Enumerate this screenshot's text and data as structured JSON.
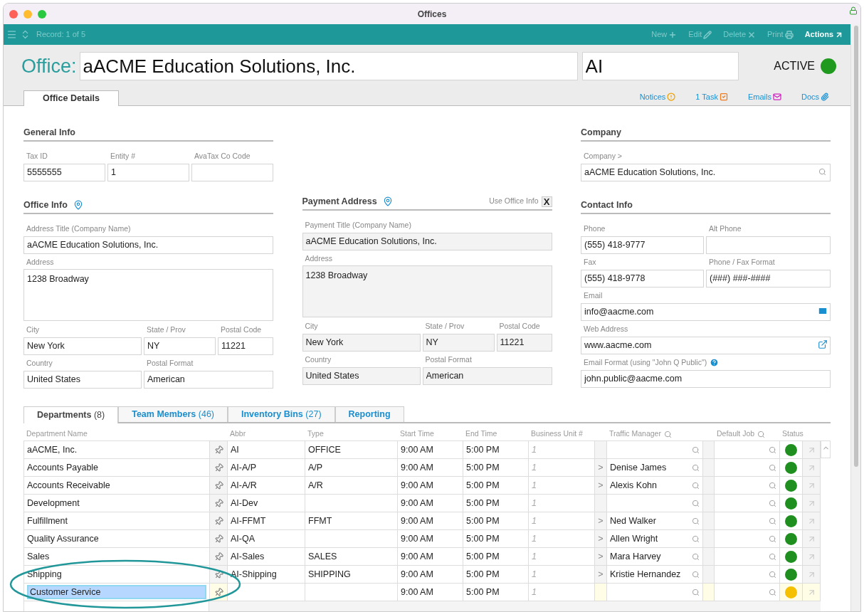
{
  "window": {
    "title": "Offices"
  },
  "toolbar": {
    "record": "Record: 1 of 5",
    "actions": [
      {
        "kind": "new",
        "label": "New",
        "disabled": true
      },
      {
        "kind": "edit",
        "label": "Edit",
        "disabled": true
      },
      {
        "kind": "delete",
        "label": "Delete",
        "disabled": true
      },
      {
        "kind": "print",
        "label": "Print",
        "disabled": true
      },
      {
        "kind": "actions",
        "label": "Actions",
        "disabled": false
      }
    ]
  },
  "header": {
    "label": "Office:",
    "name": "aACME Education Solutions, Inc.",
    "abbr": "AI",
    "status": "ACTIVE"
  },
  "tabs": [
    {
      "label": "Office Details",
      "selected": true
    }
  ],
  "links": [
    {
      "kind": "notices",
      "label": "Notices"
    },
    {
      "kind": "task",
      "label": "1 Task"
    },
    {
      "kind": "emails",
      "label": "Emails"
    },
    {
      "kind": "docs",
      "label": "Docs"
    }
  ],
  "general_info": {
    "title": "General Info",
    "fields": [
      {
        "label": "Tax ID",
        "value": "5555555"
      },
      {
        "label": "Entity #",
        "value": "1"
      },
      {
        "label": "AvaTax Co Code"
      }
    ]
  },
  "company": {
    "title": "Company",
    "field": {
      "label": "Company >",
      "value": "aACME Education Solutions, Inc."
    }
  },
  "office_info": {
    "title": "Office Info",
    "title_field": {
      "label": "Address Title (Company Name)",
      "value": "aACME Education Solutions, Inc."
    },
    "address": {
      "label": "Address",
      "value": "1238 Broadway"
    },
    "city": {
      "label": "City",
      "value": "New York"
    },
    "state": {
      "label": "State / Prov",
      "value": "NY"
    },
    "postal": {
      "label": "Postal Code",
      "value": "11221"
    },
    "country": {
      "label": "Country",
      "value": "United States"
    },
    "postal_format": {
      "label": "Postal Format",
      "value": "American"
    }
  },
  "payment_address": {
    "title": "Payment Address",
    "use_office_info": {
      "label": "Use Office Info",
      "checked": true,
      "mark": "X"
    },
    "title_field": {
      "label": "Payment Title (Company Name)",
      "value": "aACME Education Solutions, Inc."
    },
    "address": {
      "label": "Address",
      "value": "1238 Broadway"
    },
    "city": {
      "label": "City",
      "value": "New York"
    },
    "state": {
      "label": "State / Prov",
      "value": "NY"
    },
    "postal": {
      "label": "Postal Code",
      "value": "11221"
    },
    "country": {
      "label": "Country",
      "value": "United States"
    },
    "postal_format": {
      "label": "Postal Format",
      "value": "American"
    }
  },
  "contact_info": {
    "title": "Contact Info",
    "phone": {
      "label": "Phone",
      "value": "(555) 418-9777"
    },
    "alt_phone": {
      "label": "Alt Phone"
    },
    "fax": {
      "label": "Fax",
      "value": "(555) 418-9778"
    },
    "format": {
      "label": "Phone / Fax Format",
      "value": "(###) ###-####"
    },
    "email": {
      "label": "Email",
      "value": "info@aacme.com"
    },
    "web": {
      "label": "Web Address",
      "value": "www.aacme.com"
    },
    "email_format": {
      "label": "Email Format (using \"John Q Public\")",
      "value": "john.public@aacme.com"
    }
  },
  "sub_tabs": [
    {
      "label": "Departments",
      "count": "(8)",
      "selected": true
    },
    {
      "label": "Team Members",
      "count": "(46)",
      "selected": false
    },
    {
      "label": "Inventory Bins",
      "count": "(27)",
      "selected": false
    },
    {
      "label": "Reporting",
      "selected": false
    }
  ],
  "table": {
    "columns": [
      "Department Name",
      "Abbr",
      "Type",
      "Start Time",
      "End Time",
      "Business Unit #",
      "Traffic Manager",
      "Default Job",
      "Status"
    ],
    "rows": [
      {
        "name": "aACME, Inc.",
        "abbr": "AI",
        "type": "OFFICE",
        "start": "9:00 AM",
        "end": "5:00 PM",
        "unit": "1",
        "arrow": "",
        "manager": "",
        "color": "#1f8f1f",
        "selected": false
      },
      {
        "name": "Accounts Payable",
        "abbr": "AI-A/P",
        "type": "A/P",
        "start": "9:00 AM",
        "end": "5:00 PM",
        "unit": "1",
        "arrow": ">",
        "manager": "Denise James",
        "color": "#1f8f1f",
        "selected": false
      },
      {
        "name": "Accounts Receivable",
        "abbr": "AI-A/R",
        "type": "A/R",
        "start": "9:00 AM",
        "end": "5:00 PM",
        "unit": "1",
        "arrow": ">",
        "manager": "Alexis Kohn",
        "color": "#1f8f1f",
        "selected": false
      },
      {
        "name": "Development",
        "abbr": "AI-Dev",
        "type": "",
        "start": "9:00 AM",
        "end": "5:00 PM",
        "unit": "1",
        "arrow": "",
        "manager": "",
        "color": "#1f8f1f",
        "selected": false
      },
      {
        "name": "Fulfillment",
        "abbr": "AI-FFMT",
        "type": "FFMT",
        "start": "9:00 AM",
        "end": "5:00 PM",
        "unit": "1",
        "arrow": ">",
        "manager": "Ned Walker",
        "color": "#1f8f1f",
        "selected": false
      },
      {
        "name": "Quality Assurance",
        "abbr": "AI-QA",
        "type": "",
        "start": "9:00 AM",
        "end": "5:00 PM",
        "unit": "1",
        "arrow": ">",
        "manager": "Allen Wright",
        "color": "#1f8f1f",
        "selected": false
      },
      {
        "name": "Sales",
        "abbr": "AI-Sales",
        "type": "SALES",
        "start": "9:00 AM",
        "end": "5:00 PM",
        "unit": "1",
        "arrow": ">",
        "manager": "Mara Harvey",
        "color": "#1f8f1f",
        "selected": false
      },
      {
        "name": "Shipping",
        "abbr": "AI-Shipping",
        "type": "SHIPPING",
        "start": "9:00 AM",
        "end": "5:00 PM",
        "unit": "1",
        "arrow": ">",
        "manager": "Kristie Hernandez",
        "color": "#1f8f1f",
        "selected": false
      },
      {
        "name": "Customer Service",
        "abbr": "",
        "type": "",
        "start": "9:00 AM",
        "end": "5:00 PM",
        "unit": "1",
        "arrow": "",
        "manager": "",
        "color": "#f5c000",
        "selected": true
      }
    ]
  }
}
